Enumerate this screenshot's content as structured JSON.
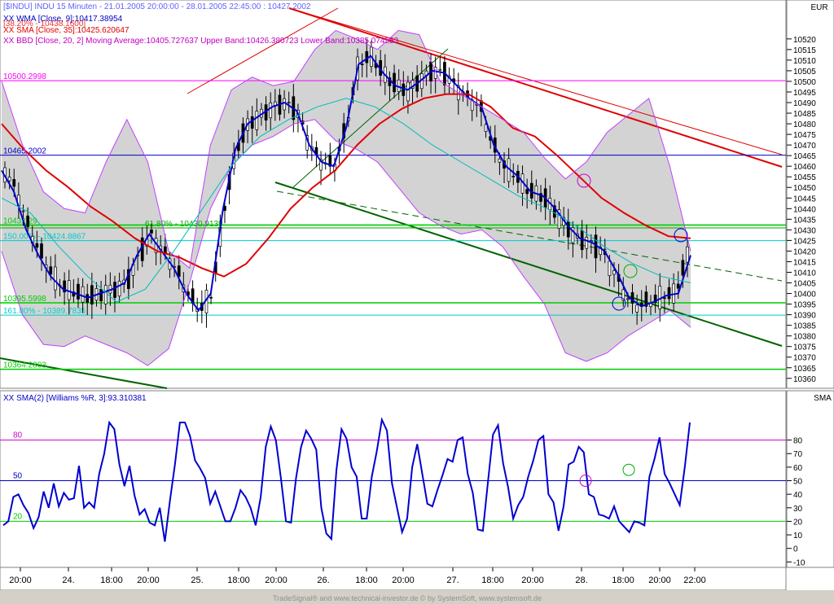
{
  "header": {
    "title": "[$INDU] INDU 15 Minuten - 21.01.2005 20:00:00 - 28.01.2005 22:45:00 : 10427.2002",
    "wma": "XX WMA [Close, 9]:10417.38954",
    "ret": "[38.20% - 10438.1600]",
    "sma": "XX SMA [Close, 35]:10425.620647",
    "bb": "XX BBD [Close, 20, 2] Moving Average:10405.727637 Upper Band:10426.380723 Lower Band:10385.074553"
  },
  "price_axis": {
    "currency": "EUR",
    "ticks": [
      "10520",
      "10515",
      "10510",
      "10505",
      "10500",
      "10495",
      "10490",
      "10485",
      "10480",
      "10475",
      "10470",
      "10465",
      "10460",
      "10455",
      "10450",
      "10445",
      "10440",
      "10435",
      "10430",
      "10425",
      "10420",
      "10415",
      "10410",
      "10405",
      "10400",
      "10395",
      "10390",
      "10385",
      "10380",
      "10375",
      "10370",
      "10365",
      "10360"
    ]
  },
  "hlines": [
    {
      "label": "10500.2998",
      "value": 10500.3,
      "color": "#ff00ff"
    },
    {
      "label": "10465.2002",
      "value": 10465.2,
      "color": "#0000c8"
    },
    {
      "label": "10432.29",
      "value": 10432.29,
      "color": "#00cc00"
    },
    {
      "label": "61.80% - 10430.9139",
      "value": 10430.91,
      "color": "#00aa00"
    },
    {
      "label": "150.00% - 10424.8867",
      "value": 10424.89,
      "color": "#00cccc"
    },
    {
      "label": "10395.5998",
      "value": 10395.6,
      "color": "#00cc00"
    },
    {
      "label": "161.80% - 10389.7835",
      "value": 10389.78,
      "color": "#00cccc"
    },
    {
      "label": "10364.2803",
      "value": 10364.28,
      "color": "#00cc00"
    }
  ],
  "x_axis": {
    "labels": [
      "20:00",
      "24.",
      "18:00",
      "20:00",
      "25.",
      "18:00",
      "20:00",
      "26.",
      "18:00",
      "20:00",
      "27.",
      "18:00",
      "20:00",
      "28.",
      "18:00",
      "20:00",
      "22:00"
    ]
  },
  "indicator": {
    "title": "XX SMA(2) [Williams %R, 3]:93.310381",
    "axis_label": "SMA",
    "ticks": [
      "80",
      "70",
      "60",
      "50",
      "40",
      "30",
      "20",
      "10",
      "0",
      "-10"
    ],
    "levels": [
      {
        "label": "80",
        "value": 80,
        "color": "#cc00cc"
      },
      {
        "label": "50",
        "value": 50,
        "color": "#0000c8"
      },
      {
        "label": "20",
        "value": 20,
        "color": "#00cc00"
      }
    ]
  },
  "footer": "TradeSignal® and www.technical-investor.de © by SystemSoft, www.systemsoft.de",
  "chart_data": [
    {
      "type": "candlestick-line",
      "title": "[$INDU] INDU 15 Minuten - 21.01.2005 20:00:00 - 28.01.2005 22:45:00 : 10427.2002",
      "ylim": [
        10358,
        10532
      ],
      "series": [
        {
          "name": "XX WMA [Close, 9]",
          "color": "#0000d0",
          "values": [
            10458,
            10448,
            10430,
            10418,
            10408,
            10402,
            10400,
            10398,
            10400,
            10402,
            10405,
            10418,
            10428,
            10420,
            10412,
            10400,
            10392,
            10400,
            10440,
            10468,
            10480,
            10484,
            10488,
            10490,
            10486,
            10470,
            10462,
            10460,
            10478,
            10508,
            10512,
            10504,
            10498,
            10496,
            10500,
            10505,
            10504,
            10498,
            10492,
            10488,
            10470,
            10460,
            10455,
            10448,
            10446,
            10440,
            10432,
            10426,
            10424,
            10420,
            10410,
            10398,
            10394,
            10396,
            10399,
            10400,
            10418
          ]
        },
        {
          "name": "XX SMA [Close, 35]",
          "color": "#e00000",
          "values": [
            10480,
            10468,
            10458,
            10450,
            10441,
            10434,
            10426,
            10420,
            10417,
            10412,
            10408,
            10414,
            10426,
            10440,
            10450,
            10458,
            10470,
            10480,
            10487,
            10492,
            10494,
            10494,
            10488,
            10478,
            10474,
            10465,
            10455,
            10445,
            10438,
            10432,
            10427,
            10426
          ]
        },
        {
          "name": "XX BBD Upper Band",
          "color": "#c040ff",
          "values": [
            10500,
            10470,
            10448,
            10440,
            10438,
            10462,
            10482,
            10462,
            10420,
            10412,
            10470,
            10496,
            10502,
            10498,
            10500,
            10515,
            10524,
            10520,
            10515,
            10524,
            10522,
            10500,
            10494,
            10488,
            10482,
            10476,
            10464,
            10454,
            10462,
            10476,
            10484,
            10492,
            10460,
            10420
          ]
        },
        {
          "name": "XX BBD Lower Band",
          "color": "#c040ff",
          "values": [
            10420,
            10390,
            10376,
            10375,
            10380,
            10376,
            10372,
            10366,
            10374,
            10405,
            10440,
            10460,
            10470,
            10474,
            10480,
            10482,
            10472,
            10468,
            10462,
            10450,
            10438,
            10432,
            10428,
            10430,
            10422,
            10408,
            10395,
            10372,
            10368,
            10372,
            10380,
            10386,
            10392,
            10384
          ]
        },
        {
          "name": "XX BBD Moving Average",
          "color": "#00bbbb",
          "values": [
            10445,
            10438,
            10422,
            10408,
            10396,
            10402,
            10420,
            10440,
            10460,
            10474,
            10482,
            10488,
            10492,
            10488,
            10480,
            10470,
            10462,
            10454,
            10446,
            10440,
            10432,
            10422,
            10414,
            10408,
            10405
          ]
        }
      ]
    },
    {
      "type": "line",
      "title": "XX SMA(2) [Williams %R, 3]:93.310381",
      "ylim": [
        -14,
        102
      ],
      "series": [
        {
          "name": "XX SMA(2) [Williams %R, 3]",
          "color": "#0000d0",
          "values": [
            17,
            20,
            38,
            40,
            32,
            26,
            15,
            23,
            42,
            30,
            48,
            31,
            41,
            36,
            37,
            61,
            30,
            34,
            30,
            55,
            70,
            93,
            88,
            62,
            46,
            61,
            39,
            25,
            29,
            19,
            17,
            30,
            5,
            35,
            62,
            93,
            93,
            83,
            65,
            59,
            52,
            33,
            42,
            31,
            20,
            20,
            30,
            43,
            38,
            30,
            17,
            38,
            75,
            90,
            80,
            52,
            20,
            19,
            52,
            75,
            87,
            81,
            73,
            30,
            11,
            7,
            58,
            88,
            81,
            60,
            53,
            22,
            22,
            53,
            72,
            95,
            87,
            48,
            30,
            12,
            22,
            60,
            77,
            55,
            33,
            31,
            43,
            54,
            66,
            64,
            80,
            82,
            55,
            41,
            14,
            13,
            49,
            84,
            91,
            63,
            45,
            22,
            32,
            38,
            53,
            65,
            80,
            83,
            40,
            34,
            13,
            31,
            62,
            64,
            75,
            71,
            40,
            38,
            25,
            24,
            22,
            31,
            20,
            16,
            12,
            20,
            19,
            17,
            53,
            66,
            82,
            55,
            48,
            40,
            32,
            60,
            93
          ]
        }
      ]
    }
  ]
}
